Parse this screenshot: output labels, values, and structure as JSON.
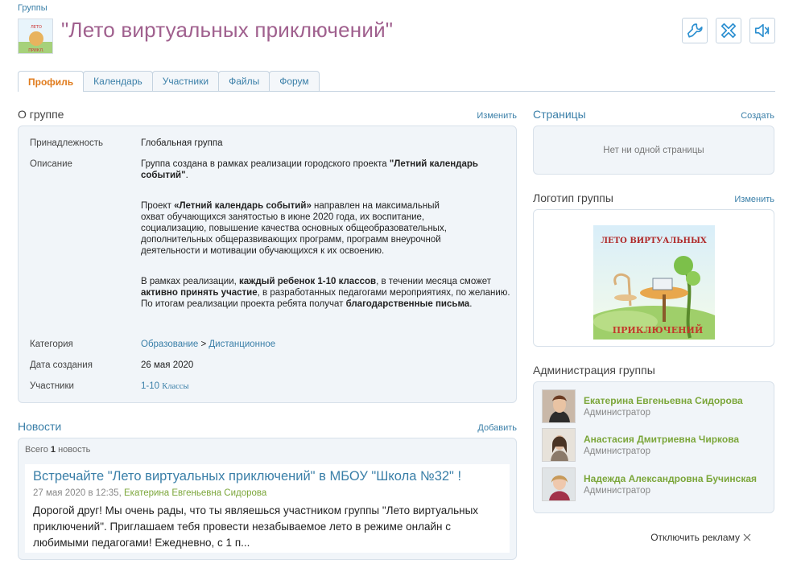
{
  "breadcrumb": "Группы",
  "page_title": "\"Лето виртуальных приключений\"",
  "toolbar": {
    "icons": [
      "wrench-icon",
      "remove-icon",
      "mute-icon"
    ]
  },
  "tabs": [
    {
      "label": "Профиль",
      "active": true
    },
    {
      "label": "Календарь",
      "active": false
    },
    {
      "label": "Участники",
      "active": false
    },
    {
      "label": "Файлы",
      "active": false
    },
    {
      "label": "Форум",
      "active": false
    }
  ],
  "about": {
    "title": "О группе",
    "edit_label": "Изменить",
    "membership_label": "Принадлежность",
    "membership_value": "Глобальная группа",
    "description_label": "Описание",
    "description_p1_pre": "Группа создана в рамках реализации городского проекта ",
    "description_p1_bold": "\"Летний календарь событий\"",
    "description_p1_post": ".",
    "description_p2_pre": "Проект ",
    "description_p2_bold": "«Летний календарь событий»",
    "description_p2_post": " направлен на максимальный охват обучающихся занятостью в июне 2020 года, их воспитание, социализацию, повышение качества основных общеобразовательных, дополнительных общеразвивающих программ, программ внеурочной деятельности и мотивации обучающихся к их освоению.",
    "description_p3_a": "В рамках реализации, ",
    "description_p3_b": "каждый ребенок 1-10 классов",
    "description_p3_c": ", в течении месяца сможет ",
    "description_p3_d": "активно принять участие",
    "description_p3_e": ", в разработанных педагогами мероприятиях, по желанию. По итогам реализации проекта ребята получат ",
    "description_p3_f": "благодарственные письма",
    "description_p3_g": ".",
    "category_label": "Категория",
    "category_parent": "Образование",
    "category_sep": " > ",
    "category_child": "Дистанционное",
    "created_label": "Дата создания",
    "created_value": "26 мая 2020",
    "participants_label": "Участники",
    "participants_value": "1-10",
    "participants_suffix": "Классы"
  },
  "pages": {
    "title": "Страницы",
    "create_label": "Создать",
    "empty": "Нет ни одной страницы"
  },
  "logo": {
    "title": "Логотип группы",
    "edit_label": "Изменить",
    "top_text": "ЛЕТО ВИРТУАЛЬНЫХ",
    "bottom_text": "ПРИКЛЮЧЕНИЙ"
  },
  "admins": {
    "title": "Администрация группы",
    "items": [
      {
        "name": "Екатерина Евгеньевна Сидорова",
        "role": "Администратор"
      },
      {
        "name": "Анастасия Дмитриевна Чиркова",
        "role": "Администратор"
      },
      {
        "name": "Надежда Александровна Бучинская",
        "role": "Администратор"
      }
    ]
  },
  "news": {
    "title": "Новости",
    "add_label": "Добавить",
    "count_pre": "Всего ",
    "count_num": "1",
    "count_post": " новость",
    "item": {
      "title": "Встречайте \"Лето виртуальных приключений\" в МБОУ \"Школа №32\" !",
      "date": "27 мая 2020 в 12:35,",
      "author": "Екатерина Евгеньевна Сидорова",
      "text": "Дорогой друг! Мы очень рады, что ты являешься участником группы \"Лето виртуальных приключений\".  Приглашаем тебя провести незабываемое лето в режиме онлайн с любимыми педагогами! Ежедневно, с 1 п..."
    }
  },
  "ads_off_label": "Отключить рекламу",
  "colors": {
    "title": "#a0608e",
    "link": "#3a7fa8",
    "active_tab": "#e07b1c",
    "admin_name": "#7ba63a",
    "panel_bg": "#f1f5f9"
  }
}
